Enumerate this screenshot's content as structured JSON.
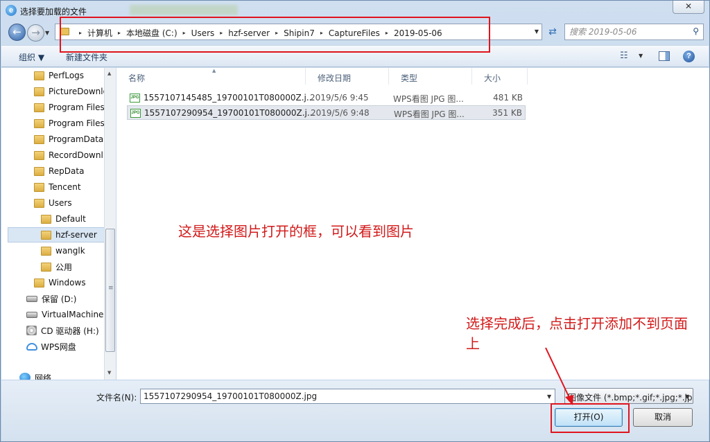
{
  "window": {
    "title": "选择要加载的文件"
  },
  "nav": {
    "back_glyph": "←",
    "forward_glyph": "→",
    "history_glyph": "▼"
  },
  "address": {
    "crumbs": [
      "计算机",
      "本地磁盘 (C:)",
      "Users",
      "hzf-server",
      "Shipin7",
      "CaptureFiles",
      "2019-05-06"
    ],
    "separator": "▸"
  },
  "search": {
    "placeholder": "搜索 2019-05-06"
  },
  "toolbar": {
    "organize": "组织 ▼",
    "new_folder": "新建文件夹"
  },
  "sidebar": {
    "items": [
      {
        "label": "PerfLogs",
        "icon": "folder-icon"
      },
      {
        "label": "PictureDownlo",
        "icon": "folder-icon"
      },
      {
        "label": "Program Files",
        "icon": "folder-icon"
      },
      {
        "label": "Program Files",
        "icon": "folder-icon"
      },
      {
        "label": "ProgramData",
        "icon": "folder-icon"
      },
      {
        "label": "RecordDownl",
        "icon": "folder-icon"
      },
      {
        "label": "RepData",
        "icon": "folder-icon"
      },
      {
        "label": "Tencent",
        "icon": "folder-icon"
      },
      {
        "label": "Users",
        "icon": "folder-icon"
      },
      {
        "label": "Default",
        "icon": "folder-icon"
      },
      {
        "label": "hzf-server",
        "icon": "folder-icon"
      },
      {
        "label": "wanglk",
        "icon": "folder-icon"
      },
      {
        "label": "公用",
        "icon": "folder-icon"
      },
      {
        "label": "Windows",
        "icon": "folder-icon"
      },
      {
        "label": "保留 (D:)",
        "icon": "drive-icon"
      },
      {
        "label": "VirtualMachines",
        "icon": "drive-icon"
      },
      {
        "label": "CD 驱动器 (H:)",
        "icon": "cd-drive-icon"
      },
      {
        "label": "WPS网盘",
        "icon": "cloud-icon"
      },
      {
        "label": "网络",
        "icon": "network-icon"
      }
    ]
  },
  "columns": {
    "name": "名称",
    "date": "修改日期",
    "type": "类型",
    "size": "大小"
  },
  "files": [
    {
      "name": "1557107145485_19700101T080000Z.j...",
      "date": "2019/5/6 9:45",
      "type": "WPS看图 JPG 图...",
      "size": "481 KB"
    },
    {
      "name": "1557107290954_19700101T080000Z.j...",
      "date": "2019/5/6 9:48",
      "type": "WPS看图 JPG 图...",
      "size": "351 KB"
    }
  ],
  "file_icon_text": "JPG",
  "annotations": {
    "dialog_note": "这是选择图片打开的框，可以看到图片",
    "open_note": "选择完成后，点击打开添加不到页面上"
  },
  "bottom": {
    "filename_label": "文件名(N):",
    "filename_value": "1557107290954_19700101T080000Z.jpg",
    "filetype_value": "图像文件 (*.bmp;*.gif;*.jpg;*.jp",
    "open_button": "打开(O)",
    "cancel_button": "取消"
  },
  "colors": {
    "annotation_red": "#e0141d",
    "selection": "#d9e6f4"
  }
}
